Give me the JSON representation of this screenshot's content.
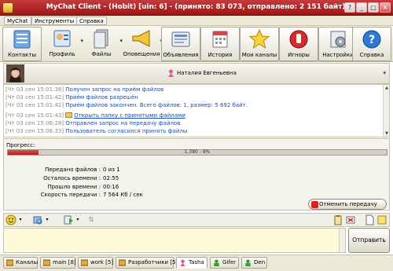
{
  "window": {
    "title": "MyChat Client - (Hobit) [uin: 6] - (принято: 83 073, отправлено: 2 151 байт)",
    "controls": [
      "?",
      "_",
      "□",
      "×"
    ]
  },
  "menu": [
    {
      "label": "MyChat"
    },
    {
      "label": "Инструменты"
    },
    {
      "label": "Справка"
    }
  ],
  "toolbar": [
    {
      "label": "Контакты",
      "icon": "contacts-icon"
    },
    {
      "label": "Профиль",
      "icon": "profile-icon"
    },
    {
      "label": "Файлы",
      "icon": "files-icon"
    },
    {
      "label": "Оповещения",
      "icon": "megaphone-icon"
    },
    {
      "label": "Объявления",
      "icon": "announcements-icon"
    },
    {
      "label": "История",
      "icon": "history-icon"
    },
    {
      "label": "Мои каналы",
      "icon": "star-icon"
    },
    {
      "label": "Игноры",
      "icon": "ignore-icon"
    },
    {
      "label": "Настройки",
      "icon": "settings-icon"
    },
    {
      "label": "Справка",
      "icon": "help-icon"
    }
  ],
  "contact": {
    "name": "Наталия Евгеньевна"
  },
  "log": [
    {
      "ts": "[Чт 03 сен 15:01:36]",
      "text": "Получен запрос на приём файлов",
      "type": "msg"
    },
    {
      "ts": "[Чт 03 сен 15:01:42]",
      "text": "Приём файлов разрешён",
      "type": "msg"
    },
    {
      "ts": "[Чт 03 сен 15:01:42]",
      "text": "Приём файлов закончен. Всего файлов: 1, размер: 5 692 байт.",
      "type": "msg"
    },
    {
      "ts": "[Чт 03 сен 15:01:43]",
      "text": "Открыть папку с принятыми файлами",
      "type": "link"
    },
    {
      "ts": "[Чт 03 сен 15:06:28]",
      "text": "Отправлен запрос на передачу файлов",
      "type": "msg"
    },
    {
      "ts": "[Чт 03 сен 15:06:33]",
      "text": "Пользователь согласился принять файлы",
      "type": "msg"
    }
  ],
  "transfer": {
    "progress_label": "Прогресс:",
    "progress_text": "1,380 - 8%",
    "progress_fraction": 0.08,
    "stats": [
      {
        "key": "Передано файлов :",
        "value": "0 из 1"
      },
      {
        "key": "Осталось времени :",
        "value": "02:55"
      },
      {
        "key": "Прошло времени :",
        "value": "00:16"
      },
      {
        "key": "Скорость передачи :",
        "value": "7 564 Кб / сек"
      }
    ],
    "cancel_label": "Отменить передачу"
  },
  "input": {
    "value": "",
    "send_label": "Отправить"
  },
  "tabs": [
    {
      "label": "Каналы",
      "icon": "channels-icon"
    },
    {
      "label": "main [8]",
      "icon": "channel-icon"
    },
    {
      "label": "work [5]",
      "icon": "channel-icon"
    },
    {
      "label": "Разработчики [5]",
      "icon": "channel-icon"
    },
    {
      "label": "Tasha",
      "icon": "female-user-icon",
      "active": true
    },
    {
      "label": "Gifer",
      "icon": "male-user-icon"
    },
    {
      "label": "Den",
      "icon": "male-user-icon"
    }
  ],
  "colors": {
    "titlebar": "#b42020",
    "log_text": "#1a4fb8",
    "input_bg": "#fffad9",
    "progress_fill": "#c82a2a"
  }
}
